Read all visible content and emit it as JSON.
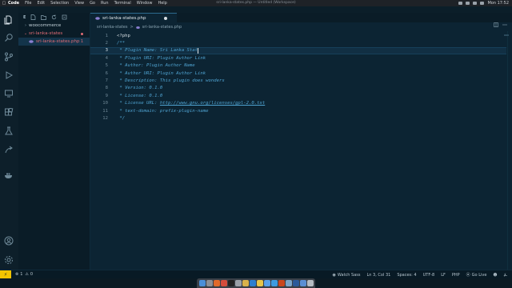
{
  "menubar": {
    "app_name": "Code",
    "menus": [
      "File",
      "Edit",
      "Selection",
      "View",
      "Go",
      "Run",
      "Terminal",
      "Window",
      "Help"
    ],
    "window_title": "sri-lanka-states.php — Untitled (Workspace)",
    "clock": "Mon 17:52"
  },
  "sidebar": {
    "items": [
      {
        "label": "woocommerce"
      },
      {
        "label": "sri-lanka-states"
      },
      {
        "label": "sri-lanka-states.php",
        "badge": "1"
      }
    ]
  },
  "tab": {
    "label": "sri-lanka-states.php"
  },
  "breadcrumb": {
    "folder": "sri-lanka-states",
    "separator": ">",
    "file": "sri-lanka-states.php"
  },
  "editor": {
    "lines": [
      {
        "num": "1",
        "text": "<?php"
      },
      {
        "num": "2",
        "text": "/**"
      },
      {
        "num": "3",
        "text": " * Plugin Name: Sri Lanka Stat"
      },
      {
        "num": "4",
        "text": " * Plugin URI: Plugin Author Link"
      },
      {
        "num": "5",
        "text": " * Author: Plugin Author Name"
      },
      {
        "num": "6",
        "text": " * Author URI: Plugin Author Link"
      },
      {
        "num": "7",
        "text": " * Description: This plugin does wonders"
      },
      {
        "num": "8",
        "text": " * Version: 0.1.0"
      },
      {
        "num": "9",
        "text": " * License: 0.1.0"
      },
      {
        "num": "10",
        "text_prefix": " * License URL: ",
        "text_link": "http://www.gnu.org/licenses/gpl-2.0.txt"
      },
      {
        "num": "11",
        "text": " * text-domain: prefix-plugin-name"
      },
      {
        "num": "12",
        "text": " */"
      }
    ],
    "active_line": "3"
  },
  "statusbar": {
    "remote": "⚡",
    "errors": "1",
    "warnings": "0",
    "watch_sass": "Watch Sass",
    "cursor_pos": "Ln 3, Col 31",
    "spaces": "Spaces: 4",
    "encoding": "UTF-8",
    "eol": "LF",
    "language": "PHP",
    "go_live": "Go Live"
  },
  "colors": {
    "editor_bg": "#0c2433",
    "comment": "#4fa3d1",
    "error": "#e06c75",
    "remote_bg": "#f2c300"
  },
  "dock": {
    "apps": [
      "finder-icon",
      "launchpad-icon",
      "firefox-icon",
      "chrome-icon",
      "terminal-icon",
      "settings-icon",
      "photos-icon",
      "vscode-icon",
      "notes-icon",
      "mail-icon",
      "safari-icon",
      "illustrator-icon",
      "preview-icon",
      "photoshop-icon",
      "folder-icon",
      "trash-icon"
    ]
  }
}
